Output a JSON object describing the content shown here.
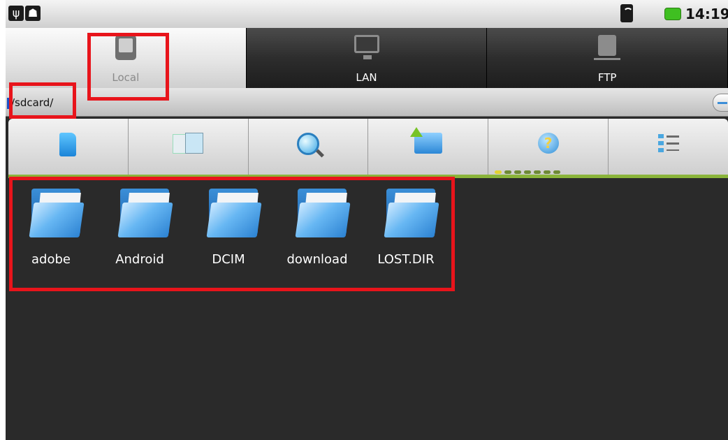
{
  "statusbar": {
    "time": "14:19",
    "icons": [
      "usb-icon",
      "android-icon",
      "wifi-icon",
      "battery-icon"
    ]
  },
  "tabs": [
    {
      "label": "Local",
      "icon": "tablet-icon",
      "active": true
    },
    {
      "label": "LAN",
      "icon": "monitor-icon",
      "active": false
    },
    {
      "label": "FTP",
      "icon": "server-icon",
      "active": false
    }
  ],
  "path": {
    "text": "/sdcard/"
  },
  "toolbar": {
    "buttons": [
      "sdcard-icon",
      "copy-icon",
      "search-icon",
      "up-folder-icon",
      "help-icon",
      "list-view-icon"
    ],
    "help_glyph": "?",
    "accent": "#8ab43a"
  },
  "files": [
    {
      "name": "adobe"
    },
    {
      "name": "Android"
    },
    {
      "name": "DCIM"
    },
    {
      "name": "download"
    },
    {
      "name": "LOST.DIR"
    }
  ],
  "colors": {
    "highlight": "#e8141b",
    "background": "#2a2a2a"
  }
}
